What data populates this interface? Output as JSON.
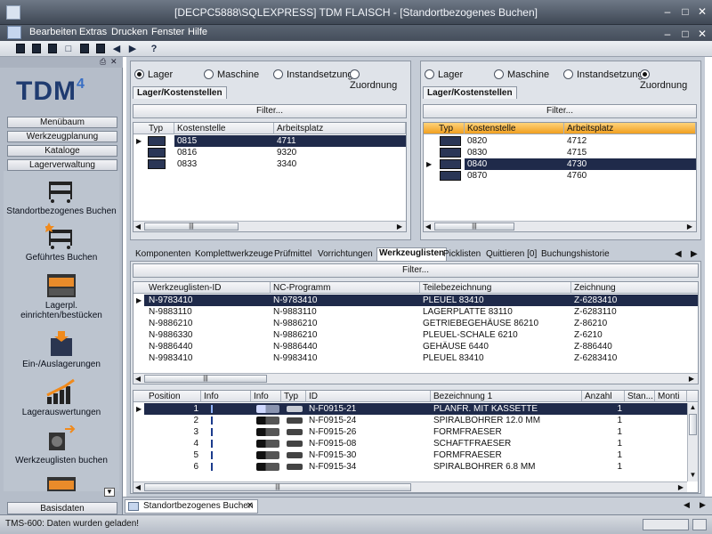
{
  "window": {
    "title": "[DECPC5888\\SQLEXPRESS] TDM FLAISCH - [Standortbezogenes Buchen]"
  },
  "menu": {
    "items": [
      "Bearbeiten",
      "Extras",
      "Drucken",
      "Fenster",
      "Hilfe"
    ]
  },
  "toolbar": {
    "help_label": "?"
  },
  "sidebar": {
    "pin_label": "I ×",
    "logo_text": "TDM",
    "logo_sup": "4",
    "nav": [
      "Menübaum",
      "Werkzeugplanung",
      "Kataloge",
      "Lagerverwaltung"
    ],
    "items": [
      {
        "label": "Standortbezogenes Buchen"
      },
      {
        "label": "Geführtes Buchen"
      },
      {
        "label": "Lagerpl. einrichten/bestücken"
      },
      {
        "label": "Ein-/Auslagerungen"
      },
      {
        "label": "Lagerauswertungen"
      },
      {
        "label": "Werkzeuglisten buchen"
      }
    ],
    "bottom_label": "Basisdaten"
  },
  "left_panel": {
    "radios": [
      {
        "label": "Lager",
        "checked": true
      },
      {
        "label": "Maschine",
        "checked": false
      },
      {
        "label": "Instandsetzung",
        "checked": false
      },
      {
        "label": "Zuordnung",
        "checked": false
      }
    ],
    "tab": "Lager/Kostenstellen",
    "filter": "Filter...",
    "columns": [
      "Typ",
      "Kostenstelle",
      "Arbeitsplatz"
    ],
    "rows": [
      {
        "kostenstelle": "0815",
        "arbeitsplatz": "4711",
        "selected": true
      },
      {
        "kostenstelle": "0816",
        "arbeitsplatz": "9320",
        "selected": false
      },
      {
        "kostenstelle": "0833",
        "arbeitsplatz": "3340",
        "selected": false
      }
    ]
  },
  "right_panel": {
    "radios": [
      {
        "label": "Lager",
        "checked": false
      },
      {
        "label": "Maschine",
        "checked": false
      },
      {
        "label": "Instandsetzung",
        "checked": false
      },
      {
        "label": "Zuordnung",
        "checked": true
      }
    ],
    "tab": "Lager/Kostenstellen",
    "filter": "Filter...",
    "columns": [
      "Typ",
      "Kostenstelle",
      "Arbeitsplatz"
    ],
    "rows": [
      {
        "kostenstelle": "0820",
        "arbeitsplatz": "4712",
        "selected": false
      },
      {
        "kostenstelle": "0830",
        "arbeitsplatz": "4715",
        "selected": false
      },
      {
        "kostenstelle": "0840",
        "arbeitsplatz": "4730",
        "selected": true
      },
      {
        "kostenstelle": "0870",
        "arbeitsplatz": "4760",
        "selected": false
      }
    ]
  },
  "lower_tabs": [
    "Komponenten",
    "Komplettwerkzeuge",
    "Prüfmittel",
    "Vorrichtungen",
    "Werkzeuglisten",
    "Picklisten",
    "Quittieren [0]",
    "Buchungshistorie"
  ],
  "active_lower_tab": "Werkzeuglisten",
  "toollist": {
    "filter": "Filter...",
    "columns": [
      "Werkzeuglisten-ID",
      "NC-Programm",
      "Teilebezeichnung",
      "Zeichnung"
    ],
    "rows": [
      {
        "id": "N-9783410",
        "nc": "N-9783410",
        "teil": "PLEUEL 83410",
        "zeichnung": "Z-6283410",
        "selected": true
      },
      {
        "id": "N-9883110",
        "nc": "N-9883110",
        "teil": "LAGERPLATTE 83110",
        "zeichnung": "Z-6283110",
        "selected": false
      },
      {
        "id": "N-9886210",
        "nc": "N-9886210",
        "teil": "GETRIEBEGEHÄUSE 86210",
        "zeichnung": "Z-86210",
        "selected": false
      },
      {
        "id": "N-9886330",
        "nc": "N-9886210",
        "teil": "PLEUEL-SCHALE 6210",
        "zeichnung": "Z-6210",
        "selected": false
      },
      {
        "id": "N-9886440",
        "nc": "N-9886440",
        "teil": "GEHÄUSE 6440",
        "zeichnung": "Z-886440",
        "selected": false
      },
      {
        "id": "N-9983410",
        "nc": "N-9983410",
        "teil": "PLEUEL 83410",
        "zeichnung": "Z-6283410",
        "selected": false
      }
    ]
  },
  "positions": {
    "columns": [
      "Position",
      "Info Position",
      "Info",
      "Typ",
      "ID",
      "Bezeichnung 1",
      "Anzahl",
      "Stan...",
      "Monti"
    ],
    "rows": [
      {
        "pos": "1",
        "id": "N-F0915-21",
        "bez": "PLANFR. MIT KASSETTE",
        "anzahl": "1",
        "selected": true
      },
      {
        "pos": "2",
        "id": "N-F0915-24",
        "bez": "SPIRALBOHRER 12.0 MM",
        "anzahl": "1",
        "selected": false
      },
      {
        "pos": "3",
        "id": "N-F0915-26",
        "bez": "FORMFRAESER",
        "anzahl": "1",
        "selected": false
      },
      {
        "pos": "4",
        "id": "N-F0915-08",
        "bez": "SCHAFTFRAESER",
        "anzahl": "1",
        "selected": false
      },
      {
        "pos": "5",
        "id": "N-F0915-30",
        "bez": "FORMFRAESER",
        "anzahl": "1",
        "selected": false
      },
      {
        "pos": "6",
        "id": "N-F0915-34",
        "bez": "SPIRALBOHRER 6.8 MM",
        "anzahl": "1",
        "selected": false
      }
    ]
  },
  "doc_tab": "Standortbezogenes Buchen",
  "status": "TMS-600: Daten wurden geladen!",
  "colors": {
    "selection": "#1f2a4a",
    "header_orange": "#f0a020"
  }
}
